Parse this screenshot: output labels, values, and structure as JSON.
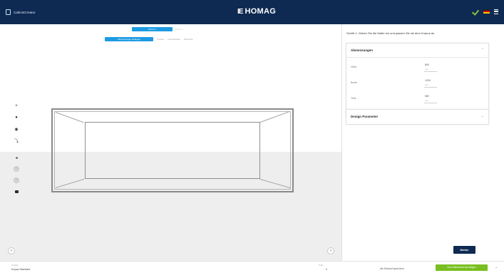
{
  "header": {
    "app_name": "CabinetCreator",
    "logo_mark": "IE",
    "brand": "HOMAG",
    "icons": [
      "check-icon",
      "flag-icon",
      "menu-icon"
    ],
    "colors": {
      "bar": "#0e2a52",
      "check": "#84c441"
    }
  },
  "steps": {
    "top_active": "Schritt 1",
    "top_ghost": "Schritt 2",
    "items": [
      "Abmessungen festlegen",
      "Fronten",
      "Innenausbau",
      "Übersicht"
    ]
  },
  "toolbar": {
    "icons": [
      "zoom-in-icon",
      "zoom-out-icon",
      "rotate-icon",
      "pan-icon",
      "view-front-icon",
      "view-side-icon",
      "view-top-icon",
      "camera-icon"
    ]
  },
  "panel": {
    "instruction": "Schritt 1: Geben Sie die Maße ein und passen Sie sie dem Korpus an.",
    "dimensions": {
      "title": "Abmessungen",
      "rows": [
        {
          "label": "Höhe",
          "value": "800",
          "unit": "mm"
        },
        {
          "label": "Breite",
          "value": "1200",
          "unit": "mm"
        },
        {
          "label": "Tiefe",
          "value": "560",
          "unit": "mm"
        }
      ]
    },
    "design": {
      "title": "Design Parameter"
    },
    "next_button": "Weiter"
  },
  "footer": {
    "left_label": "Vorlage",
    "left_value": "Korpus Standard",
    "mid_label": "Preis",
    "mid_value": "0",
    "link": "Als Entwurf speichern",
    "primary_button": "Zum Warenkorb hinzufügen",
    "colors": {
      "primary": "#78be20",
      "accent": "#1e9be2"
    }
  }
}
